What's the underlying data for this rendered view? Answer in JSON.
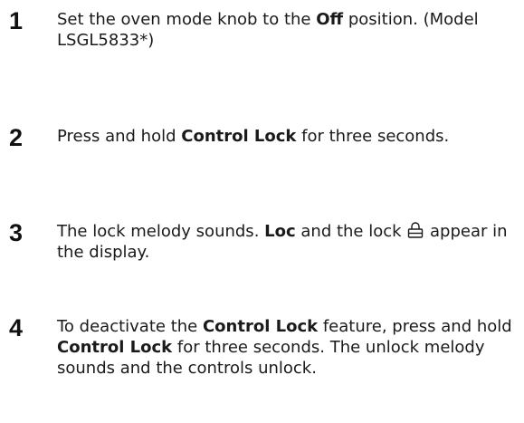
{
  "steps": [
    {
      "number": "1",
      "segments": [
        {
          "text": "Set the oven mode knob to the ",
          "bold": false
        },
        {
          "text": "Off",
          "bold": true
        },
        {
          "text": " position. (Model LSGL5833*)",
          "bold": false
        }
      ]
    },
    {
      "number": "2",
      "segments": [
        {
          "text": "Press and hold ",
          "bold": false
        },
        {
          "text": "Control Lock",
          "bold": true
        },
        {
          "text": " for three seconds.",
          "bold": false
        }
      ]
    },
    {
      "number": "3",
      "segments": [
        {
          "text": "The lock melody sounds. ",
          "bold": false
        },
        {
          "text": "Loc",
          "bold": true
        },
        {
          "text": " and the lock ",
          "bold": false
        },
        {
          "icon": "lock-icon"
        },
        {
          "text": " appear in the display.",
          "bold": false
        }
      ]
    },
    {
      "number": "4",
      "segments": [
        {
          "text": "To deactivate the ",
          "bold": false
        },
        {
          "text": "Control Lock",
          "bold": true
        },
        {
          "text": " feature, press and hold ",
          "bold": false
        },
        {
          "text": "Control Lock",
          "bold": true
        },
        {
          "text": " for three seconds. The unlock melody sounds and the controls unlock.",
          "bold": false
        }
      ]
    }
  ]
}
